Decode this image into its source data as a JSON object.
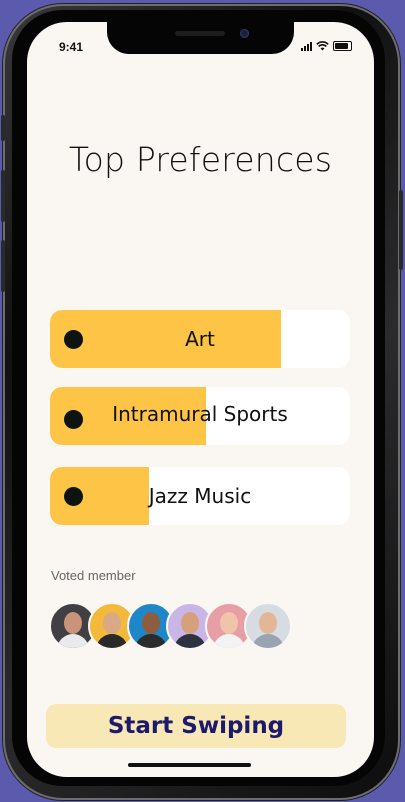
{
  "status_bar": {
    "time": "9:41"
  },
  "title": "Top Preferences",
  "preferences": [
    {
      "label": "Art",
      "level_fraction": 0.77,
      "fill_color": "#fdc445"
    },
    {
      "label": "Intramural Sports",
      "level_fraction": 0.52,
      "fill_color": "#fdc445"
    },
    {
      "label": "Jazz Music",
      "level_fraction": 0.33,
      "fill_color": "#fdc445"
    }
  ],
  "voted": {
    "label": "Voted member",
    "avatars": [
      {
        "bg": "#3f3f44",
        "skin": "#c99479",
        "shirt": "#e9eaee"
      },
      {
        "bg": "#f2b93b",
        "skin": "#d9a985",
        "shirt": "#2a2a2a"
      },
      {
        "bg": "#1f86c9",
        "skin": "#8e5c3f",
        "shirt": "#2c2c2c"
      },
      {
        "bg": "#c9b6e6",
        "skin": "#d6a07c",
        "shirt": "#2d3140"
      },
      {
        "bg": "#e79ea4",
        "skin": "#f0c4a8",
        "shirt": "#f3f3f3"
      },
      {
        "bg": "#d7dbe2",
        "skin": "#e2b697",
        "shirt": "#9aa3b1"
      }
    ]
  },
  "cta": {
    "label": "Start Swiping"
  },
  "colors": {
    "accent": "#fdc445",
    "cta_bg": "#f7e8b5",
    "cta_text": "#1d1a6e",
    "screen_bg": "#faf7f2"
  }
}
